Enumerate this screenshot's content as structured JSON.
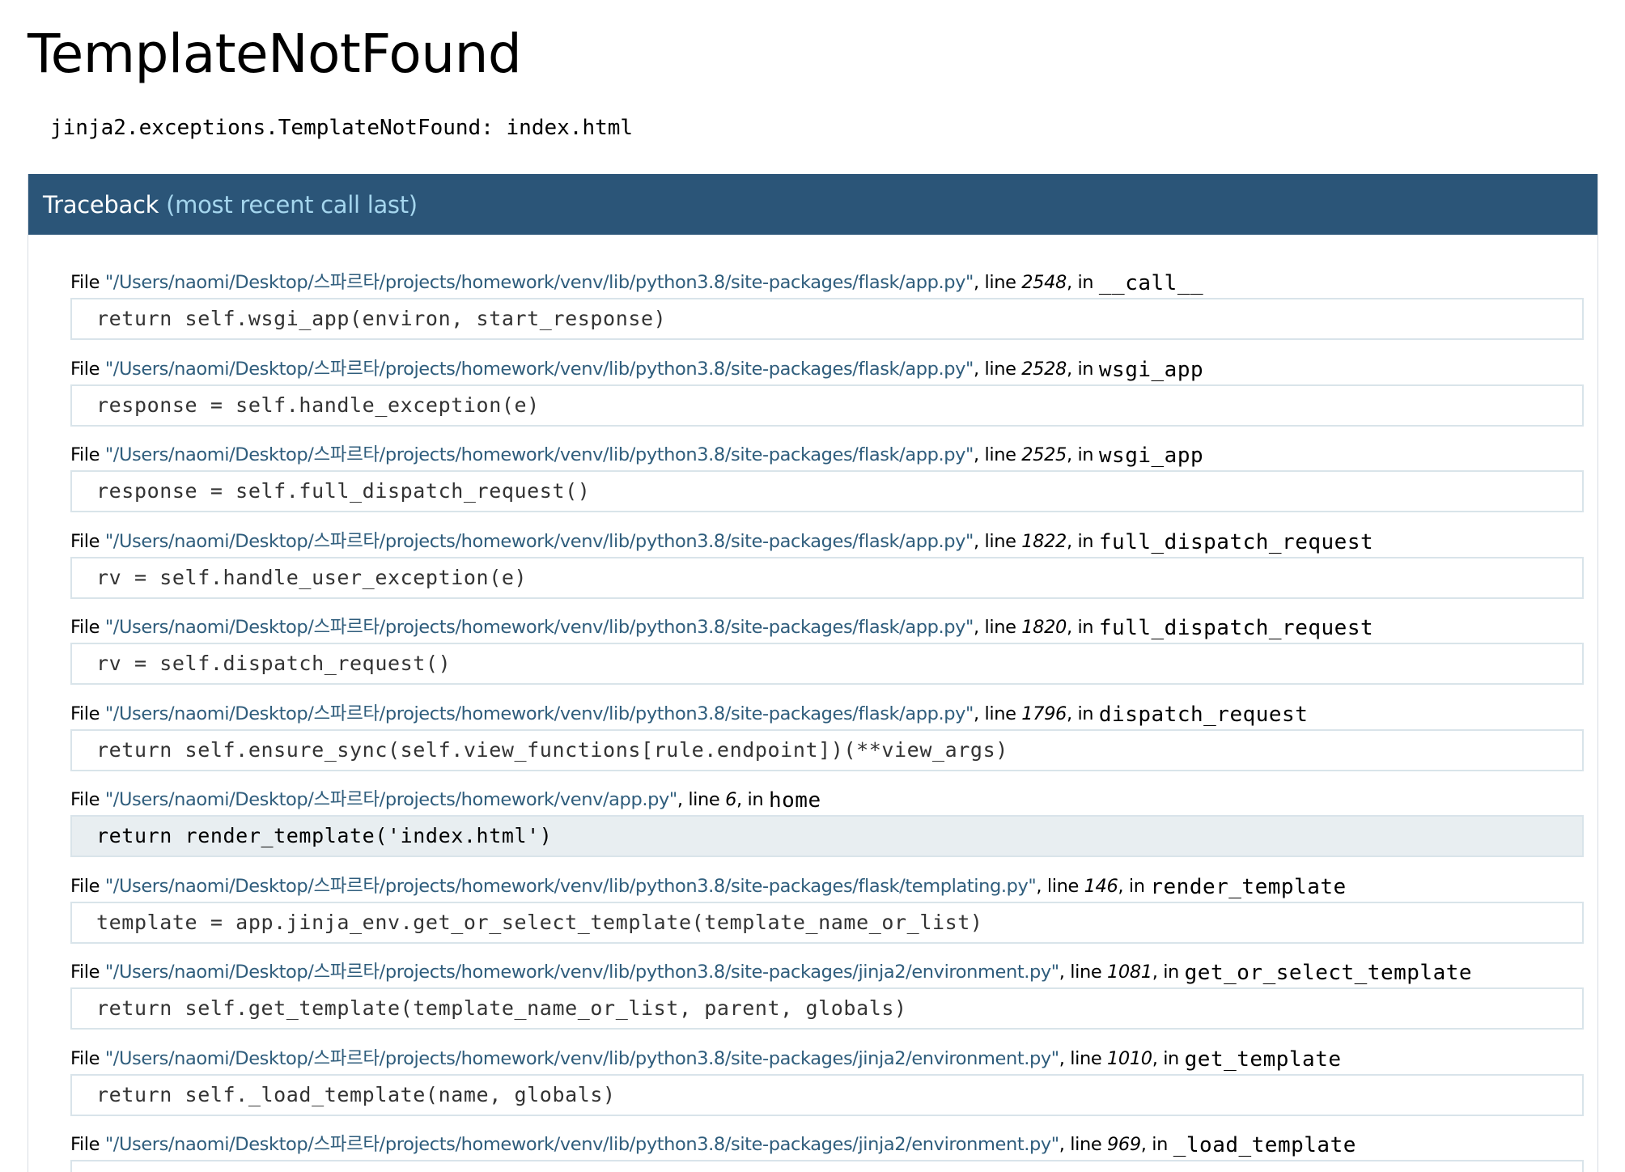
{
  "page": {
    "title": "TemplateNotFound",
    "error_message": "jinja2.exceptions.TemplateNotFound: index.html"
  },
  "traceback": {
    "header": "Traceback",
    "header_sub": "(most recent call last)",
    "frames": [
      {
        "file_prefix": "File ",
        "filename": "\"/Users/naomi/Desktop/스파르타/projects/homework/venv/lib/python3.8/site-packages/flask/app.py\"",
        "line_text": ", line ",
        "lineno": "2548",
        "in_text": ", in ",
        "function": "__call__",
        "code": "return self.wsgi_app(environ, start_response)",
        "current": false
      },
      {
        "file_prefix": "File ",
        "filename": "\"/Users/naomi/Desktop/스파르타/projects/homework/venv/lib/python3.8/site-packages/flask/app.py\"",
        "line_text": ", line ",
        "lineno": "2528",
        "in_text": ", in ",
        "function": "wsgi_app",
        "code": "response = self.handle_exception(e)",
        "current": false
      },
      {
        "file_prefix": "File ",
        "filename": "\"/Users/naomi/Desktop/스파르타/projects/homework/venv/lib/python3.8/site-packages/flask/app.py\"",
        "line_text": ", line ",
        "lineno": "2525",
        "in_text": ", in ",
        "function": "wsgi_app",
        "code": "response = self.full_dispatch_request()",
        "current": false
      },
      {
        "file_prefix": "File ",
        "filename": "\"/Users/naomi/Desktop/스파르타/projects/homework/venv/lib/python3.8/site-packages/flask/app.py\"",
        "line_text": ", line ",
        "lineno": "1822",
        "in_text": ", in ",
        "function": "full_dispatch_request",
        "code": "rv = self.handle_user_exception(e)",
        "current": false
      },
      {
        "file_prefix": "File ",
        "filename": "\"/Users/naomi/Desktop/스파르타/projects/homework/venv/lib/python3.8/site-packages/flask/app.py\"",
        "line_text": ", line ",
        "lineno": "1820",
        "in_text": ", in ",
        "function": "full_dispatch_request",
        "code": "rv = self.dispatch_request()",
        "current": false
      },
      {
        "file_prefix": "File ",
        "filename": "\"/Users/naomi/Desktop/스파르타/projects/homework/venv/lib/python3.8/site-packages/flask/app.py\"",
        "line_text": ", line ",
        "lineno": "1796",
        "in_text": ", in ",
        "function": "dispatch_request",
        "code": "return self.ensure_sync(self.view_functions[rule.endpoint])(**view_args)",
        "current": false
      },
      {
        "file_prefix": "File ",
        "filename": "\"/Users/naomi/Desktop/스파르타/projects/homework/venv/app.py\"",
        "line_text": ", line ",
        "lineno": "6",
        "in_text": ", in ",
        "function": "home",
        "code": "return render_template('index.html')",
        "current": true
      },
      {
        "file_prefix": "File ",
        "filename": "\"/Users/naomi/Desktop/스파르타/projects/homework/venv/lib/python3.8/site-packages/flask/templating.py\"",
        "line_text": ", line ",
        "lineno": "146",
        "in_text": ", in ",
        "function": "render_template",
        "code": "template = app.jinja_env.get_or_select_template(template_name_or_list)",
        "current": false
      },
      {
        "file_prefix": "File ",
        "filename": "\"/Users/naomi/Desktop/스파르타/projects/homework/venv/lib/python3.8/site-packages/jinja2/environment.py\"",
        "line_text": ", line ",
        "lineno": "1081",
        "in_text": ", in ",
        "function": "get_or_select_template",
        "code": "return self.get_template(template_name_or_list, parent, globals)",
        "current": false
      },
      {
        "file_prefix": "File ",
        "filename": "\"/Users/naomi/Desktop/스파르타/projects/homework/venv/lib/python3.8/site-packages/jinja2/environment.py\"",
        "line_text": ", line ",
        "lineno": "1010",
        "in_text": ", in ",
        "function": "get_template",
        "code": "return self._load_template(name, globals)",
        "current": false
      },
      {
        "file_prefix": "File ",
        "filename": "\"/Users/naomi/Desktop/스파르타/projects/homework/venv/lib/python3.8/site-packages/jinja2/environment.py\"",
        "line_text": ", line ",
        "lineno": "969",
        "in_text": ", in ",
        "function": "_load_template",
        "code": "",
        "current": false
      }
    ]
  },
  "colors": {
    "header_bg": "#2b5578",
    "header_sub": "#a5d6ee",
    "filename_link": "#2f5d7c",
    "current_frame_bg": "#e8eef1"
  }
}
